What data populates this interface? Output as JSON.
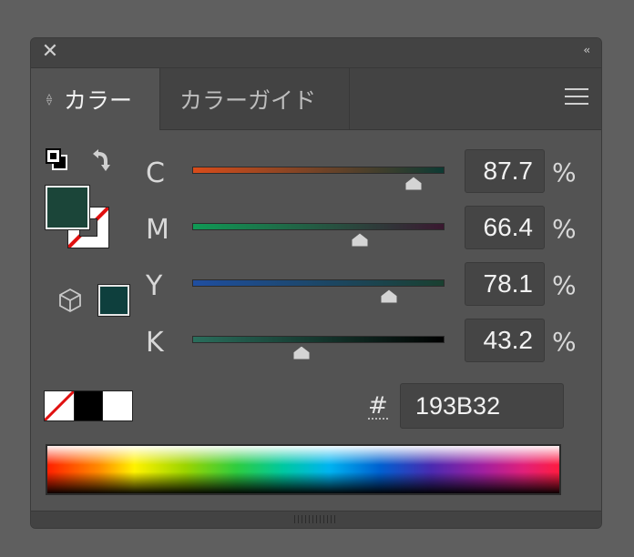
{
  "titlebar": {
    "close_icon": "close-icon",
    "collapse_label": "‹‹"
  },
  "tabs": {
    "active": {
      "label": "カラー"
    },
    "inactive": {
      "label": "カラーガイド"
    }
  },
  "sliders": [
    {
      "channel": "C",
      "value": "87.7",
      "unit": "%",
      "position": 0.877,
      "gradient": [
        "#d94c1a",
        "#0d3a33"
      ]
    },
    {
      "channel": "M",
      "value": "66.4",
      "unit": "%",
      "position": 0.664,
      "gradient": [
        "#0f9a55",
        "#3a1830"
      ]
    },
    {
      "channel": "Y",
      "value": "78.1",
      "unit": "%",
      "position": 0.781,
      "gradient": [
        "#1f4ea0",
        "#1a4030"
      ]
    },
    {
      "channel": "K",
      "value": "43.2",
      "unit": "%",
      "position": 0.432,
      "gradient": [
        "#2a6e5c",
        "#000000"
      ]
    }
  ],
  "hex": {
    "symbol": "#",
    "value": "193B32"
  },
  "colors": {
    "fill": "#1b4539",
    "gamut_swatch": "#0e3f3d"
  }
}
